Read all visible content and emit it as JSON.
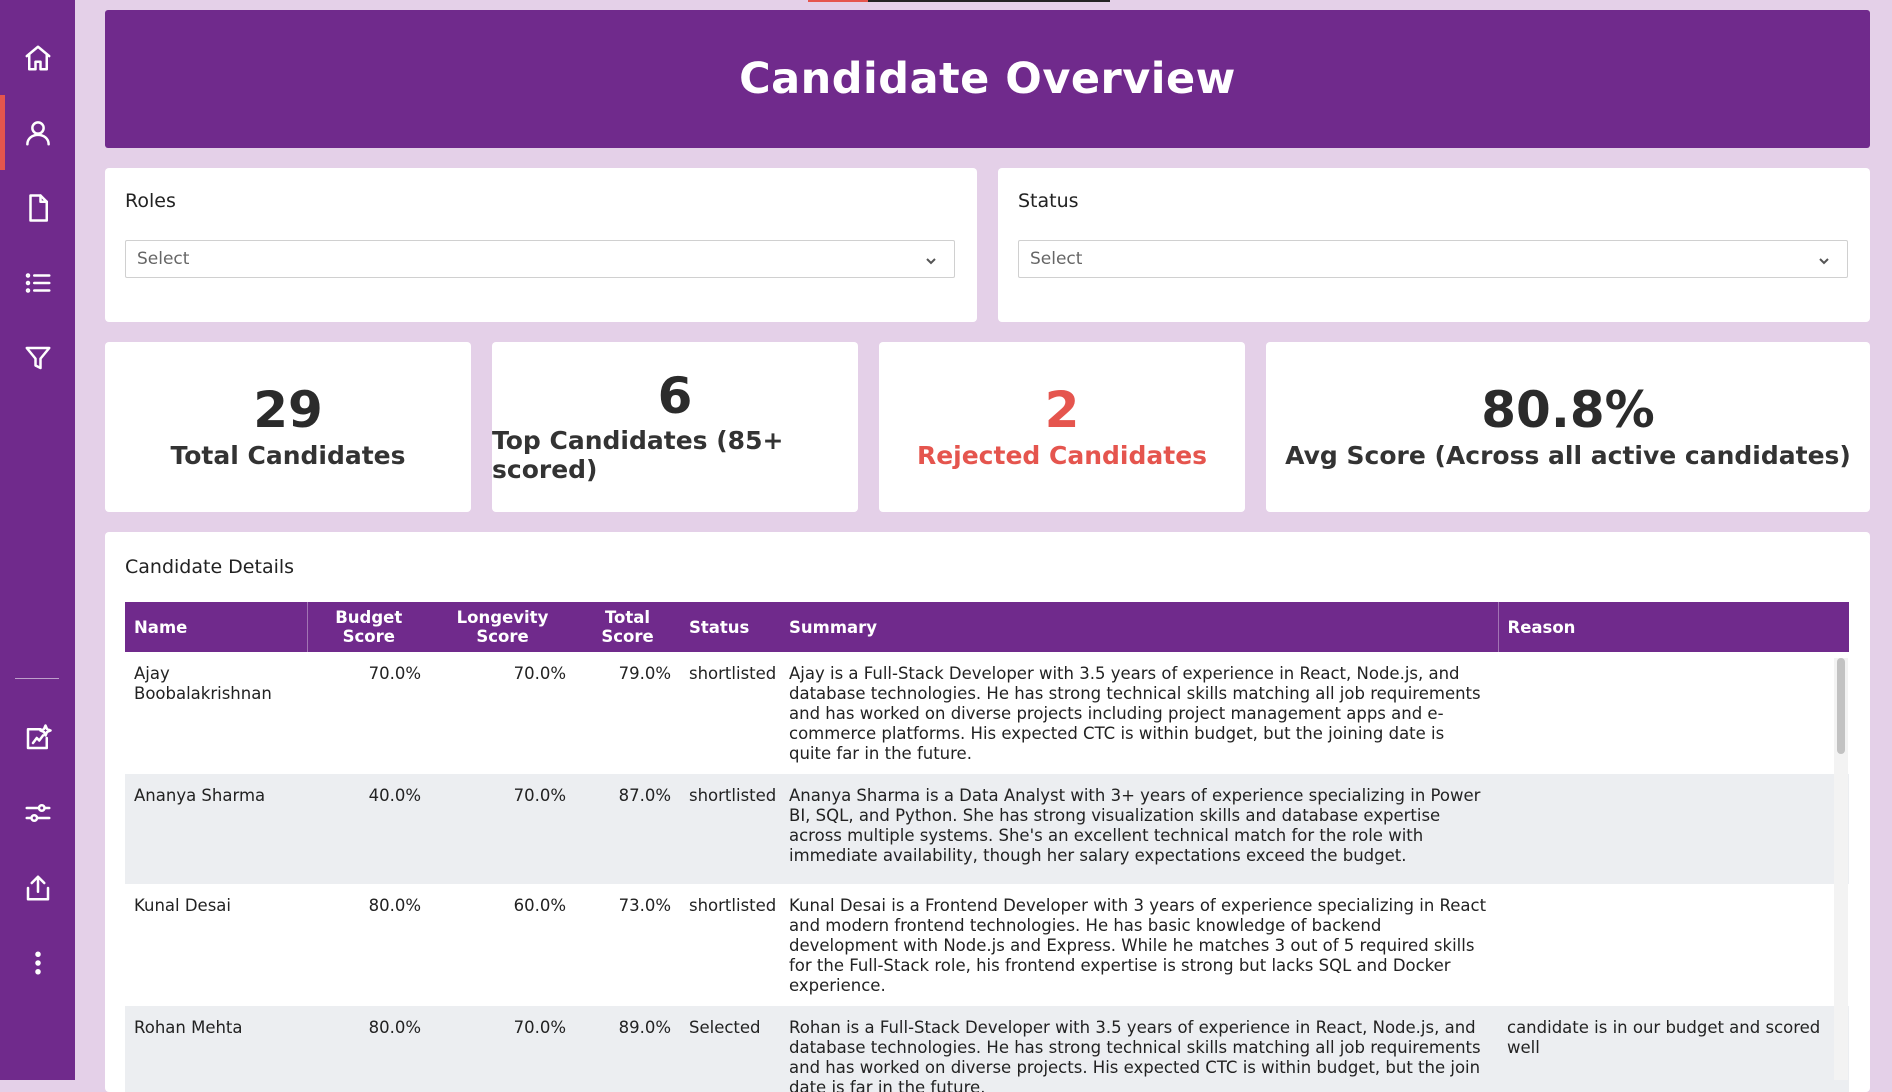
{
  "header": {
    "title": "Candidate Overview"
  },
  "sidebar": {
    "items": [
      {
        "icon": "home-icon",
        "active": false
      },
      {
        "icon": "user-icon",
        "active": true
      },
      {
        "icon": "document-icon",
        "active": false
      },
      {
        "icon": "list-icon",
        "active": false
      },
      {
        "icon": "filter-icon",
        "active": false
      },
      {
        "icon": "ai-insights-icon",
        "active": false
      },
      {
        "icon": "sliders-icon",
        "active": false
      },
      {
        "icon": "share-icon",
        "active": false
      },
      {
        "icon": "more-icon",
        "active": false
      }
    ]
  },
  "filters": {
    "roles": {
      "label": "Roles",
      "value": "Select"
    },
    "status": {
      "label": "Status",
      "value": "Select"
    }
  },
  "kpis": [
    {
      "value": "29",
      "label": "Total Candidates"
    },
    {
      "value": "6",
      "label": "Top Candidates (85+ scored)"
    },
    {
      "value": "2",
      "label": "Rejected Candidates"
    },
    {
      "value": "80.8%",
      "label": "Avg Score (Across all active candidates)"
    }
  ],
  "details": {
    "title": "Candidate Details",
    "columns": [
      "Name",
      "Budget Score",
      "Longevity Score",
      "Total Score",
      "Status",
      "Summary",
      "Reason"
    ],
    "rows": [
      {
        "name": "Ajay Boobalakrishnan",
        "budget": "70.0%",
        "longevity": "70.0%",
        "total": "79.0%",
        "status": "shortlisted",
        "summary": "Ajay is a Full-Stack Developer with 3.5 years of experience in React, Node.js, and database technologies. He has strong technical skills matching all job requirements and has worked on diverse projects including project management apps and e-commerce platforms. His expected CTC is within budget, but the joining date is quite far in the future.",
        "reason": ""
      },
      {
        "name": "Ananya Sharma",
        "budget": "40.0%",
        "longevity": "70.0%",
        "total": "87.0%",
        "status": "shortlisted",
        "summary": "Ananya Sharma is a Data Analyst with 3+ years of experience specializing in Power BI, SQL, and Python. She has strong visualization skills and database expertise across multiple systems. She's an excellent technical match for the role with immediate availability, though her salary expectations exceed the budget.",
        "reason": ""
      },
      {
        "name": "Kunal Desai",
        "budget": "80.0%",
        "longevity": "60.0%",
        "total": "73.0%",
        "status": "shortlisted",
        "summary": "Kunal Desai is a Frontend Developer with 3 years of experience specializing in React and modern frontend technologies. He has basic knowledge of backend development with Node.js and Express. While he matches 3 out of 5 required skills for the Full-Stack role, his frontend expertise is strong but lacks SQL and Docker experience.",
        "reason": ""
      },
      {
        "name": "Rohan Mehta",
        "budget": "80.0%",
        "longevity": "70.0%",
        "total": "89.0%",
        "status": "Selected",
        "summary": "Rohan is a Full-Stack Developer with 3.5 years of experience in React, Node.js, and database technologies. He has strong technical skills matching all job requirements and has worked on diverse projects. His expected CTC is within budget, but the join date is far in the future.",
        "reason": "candidate is in our budget and scored well"
      }
    ]
  },
  "colors": {
    "brand": "#702a8c",
    "accent": "#e5554e",
    "background": "#e4d0e8"
  }
}
